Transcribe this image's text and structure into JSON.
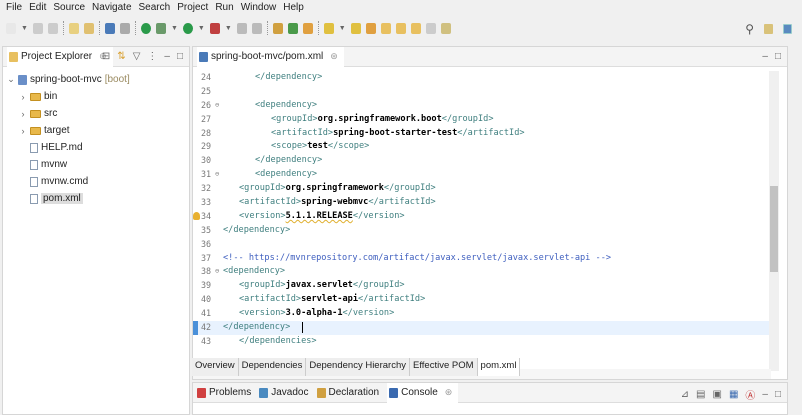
{
  "menu": [
    "File",
    "Edit",
    "Source",
    "Navigate",
    "Search",
    "Project",
    "Run",
    "Window",
    "Help"
  ],
  "project_explorer": {
    "title": "Project Explorer",
    "project": {
      "name": "spring-boot-mvc",
      "tag": "[boot]"
    },
    "items": [
      {
        "label": "bin",
        "type": "folder"
      },
      {
        "label": "src",
        "type": "folder"
      },
      {
        "label": "target",
        "type": "folder"
      },
      {
        "label": "HELP.md",
        "type": "file"
      },
      {
        "label": "mvnw",
        "type": "file"
      },
      {
        "label": "mvnw.cmd",
        "type": "file"
      },
      {
        "label": "pom.xml",
        "type": "file",
        "selected": true
      }
    ]
  },
  "editor": {
    "tab_title": "spring-boot-mvc/pom.xml",
    "lines": [
      {
        "n": "24",
        "i": 2,
        "s": [
          [
            "tag",
            "</dependency>"
          ]
        ]
      },
      {
        "n": "25",
        "i": 0,
        "s": []
      },
      {
        "n": "26",
        "i": 2,
        "f": true,
        "s": [
          [
            "tag",
            "<dependency>"
          ]
        ]
      },
      {
        "n": "27",
        "i": 3,
        "s": [
          [
            "tag",
            "<groupId>"
          ],
          [
            "txt",
            "org.springframework.boot"
          ],
          [
            "tag",
            "</groupId>"
          ]
        ]
      },
      {
        "n": "28",
        "i": 3,
        "s": [
          [
            "tag",
            "<artifactId>"
          ],
          [
            "txt",
            "spring-boot-starter-test"
          ],
          [
            "tag",
            "</artifactId>"
          ]
        ]
      },
      {
        "n": "29",
        "i": 3,
        "s": [
          [
            "tag",
            "<scope>"
          ],
          [
            "txt",
            "test"
          ],
          [
            "tag",
            "</scope>"
          ]
        ]
      },
      {
        "n": "30",
        "i": 2,
        "s": [
          [
            "tag",
            "</dependency>"
          ]
        ]
      },
      {
        "n": "31",
        "i": 2,
        "f": true,
        "s": [
          [
            "tag",
            "<dependency>"
          ]
        ]
      },
      {
        "n": "32",
        "i": 1,
        "s": [
          [
            "tag",
            "<groupId>"
          ],
          [
            "txt",
            "org.springframework"
          ],
          [
            "tag",
            "</groupId>"
          ]
        ]
      },
      {
        "n": "33",
        "i": 1,
        "s": [
          [
            "tag",
            "<artifactId>"
          ],
          [
            "txt",
            "spring-webmvc"
          ],
          [
            "tag",
            "</artifactId>"
          ]
        ]
      },
      {
        "n": "34",
        "i": 1,
        "w": true,
        "s": [
          [
            "tag",
            "<version>"
          ],
          [
            "txt",
            "5.1.1.RELEASE"
          ],
          [
            "tag",
            "</version>"
          ]
        ]
      },
      {
        "n": "35",
        "i": 0,
        "s": [
          [
            "tag",
            "</dependency>"
          ]
        ]
      },
      {
        "n": "36",
        "i": 0,
        "s": []
      },
      {
        "n": "37",
        "i": 0,
        "s": [
          [
            "cmt",
            "<!-- https://mvnrepository.com/artifact/javax.servlet/javax.servlet-api -->"
          ]
        ]
      },
      {
        "n": "38",
        "i": 0,
        "f": true,
        "s": [
          [
            "tag",
            "<dependency>"
          ]
        ]
      },
      {
        "n": "39",
        "i": 1,
        "s": [
          [
            "tag",
            "<groupId>"
          ],
          [
            "txt",
            "javax.servlet"
          ],
          [
            "tag",
            "</groupId>"
          ]
        ]
      },
      {
        "n": "40",
        "i": 1,
        "s": [
          [
            "tag",
            "<artifactId>"
          ],
          [
            "txt",
            "servlet-api"
          ],
          [
            "tag",
            "</artifactId>"
          ]
        ]
      },
      {
        "n": "41",
        "i": 1,
        "s": [
          [
            "tag",
            "<version>"
          ],
          [
            "txt",
            "3.0-alpha-1"
          ],
          [
            "tag",
            "</version>"
          ]
        ]
      },
      {
        "n": "42",
        "i": 0,
        "cur": true,
        "s": [
          [
            "tag",
            "</dependency>"
          ]
        ]
      },
      {
        "n": "43",
        "i": 1,
        "s": [
          [
            "tag",
            "</dependencies>"
          ]
        ]
      }
    ],
    "bottom_tabs": [
      "Overview",
      "Dependencies",
      "Dependency Hierarchy",
      "Effective POM",
      "pom.xml"
    ],
    "active_bottom_tab": 4
  },
  "bottom_panel": {
    "tabs": [
      "Problems",
      "Javadoc",
      "Declaration",
      "Console"
    ],
    "active": 3
  }
}
